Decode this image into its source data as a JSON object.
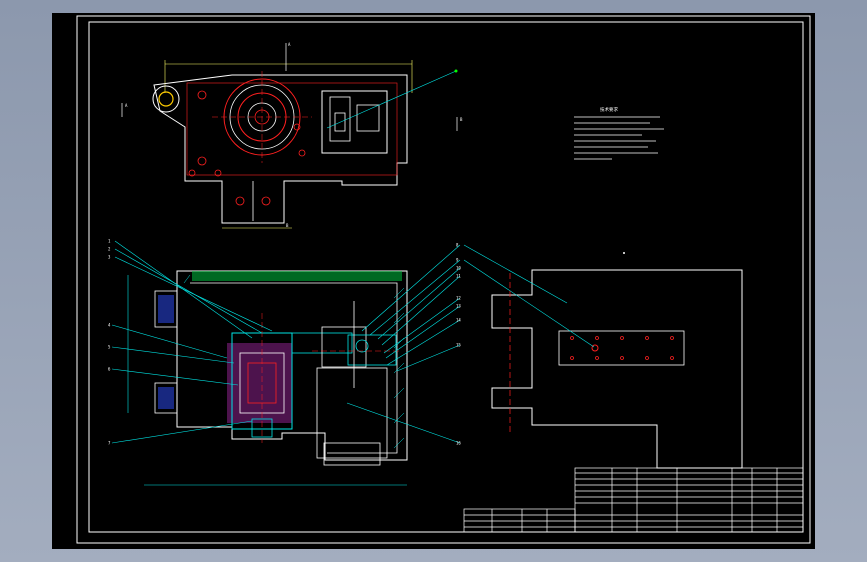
{
  "colors": {
    "background": "#000000",
    "frame": "#ffffff",
    "outline": "#ffffff",
    "part": "#00e5e5",
    "detail": "#00ff00",
    "hidden": "#ff2020",
    "dimension": "#ffff66",
    "highlight": "#ff40ff"
  },
  "notes": {
    "title": "技术要求",
    "lines": [
      "1.",
      "2.",
      "3.",
      "4."
    ]
  },
  "callouts_left": [
    "1",
    "2",
    "3",
    "4",
    "5",
    "6",
    "7"
  ],
  "callouts_right": [
    "8",
    "9",
    "10",
    "11",
    "12",
    "13",
    "14",
    "15",
    "16"
  ],
  "section_marks": [
    "A",
    "A",
    "B",
    "B"
  ],
  "title_block": {
    "rows": 12
  }
}
